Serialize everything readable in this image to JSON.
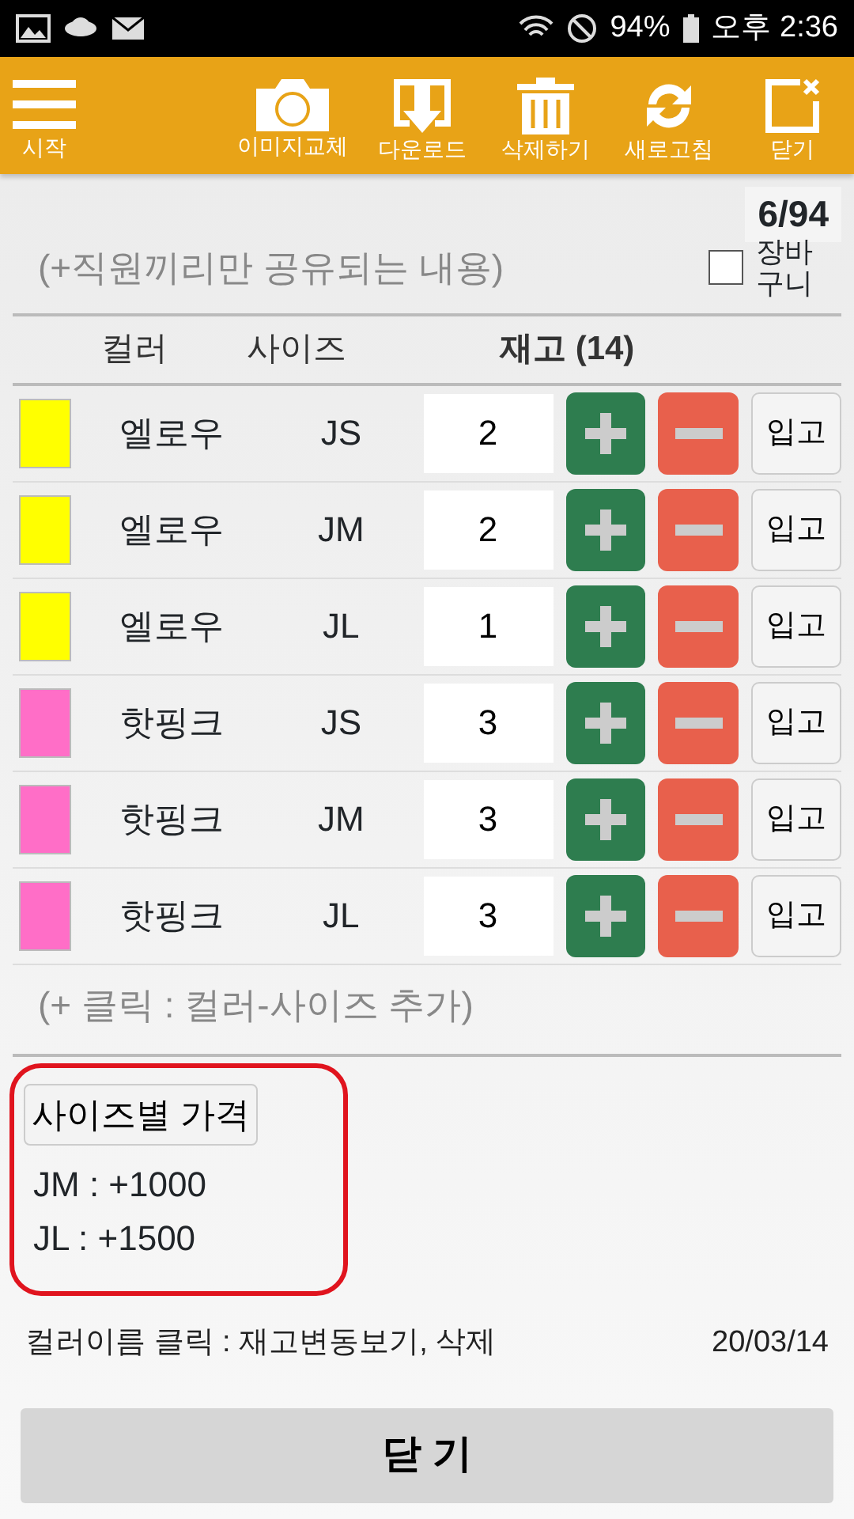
{
  "status_bar": {
    "battery": "94%",
    "time": "오후 2:36"
  },
  "toolbar": {
    "menu_label": "시작",
    "actions": [
      {
        "kind": "camera",
        "label": "이미지교체"
      },
      {
        "kind": "download",
        "label": "다운로드"
      },
      {
        "kind": "trash",
        "label": "삭제하기"
      },
      {
        "kind": "refresh",
        "label": "새로고침"
      },
      {
        "kind": "close",
        "label": "닫기"
      }
    ]
  },
  "counter": "6/94",
  "note": "(+직원끼리만 공유되는 내용)",
  "cart": {
    "label": "장바구니",
    "checked": false
  },
  "table": {
    "columns": [
      "컬러",
      "사이즈",
      "재고 (14)"
    ],
    "rows": [
      {
        "color": "#ffff00",
        "name": "엘로우",
        "size": "JS",
        "qty": "2",
        "button": "입고"
      },
      {
        "color": "#ffff00",
        "name": "엘로우",
        "size": "JM",
        "qty": "2",
        "button": "입고"
      },
      {
        "color": "#ffff00",
        "name": "엘로우",
        "size": "JL",
        "qty": "1",
        "button": "입고"
      },
      {
        "color": "#ff6ec7",
        "name": "핫핑크",
        "size": "JS",
        "qty": "3",
        "button": "입고"
      },
      {
        "color": "#ff6ec7",
        "name": "핫핑크",
        "size": "JM",
        "qty": "3",
        "button": "입고"
      },
      {
        "color": "#ff6ec7",
        "name": "핫핑크",
        "size": "JL",
        "qty": "3",
        "button": "입고"
      }
    ]
  },
  "add_note": "(+ 클릭 : 컬러-사이즈 추가)",
  "price_button": "사이즈별 가격",
  "prices": [
    "JM : +1000",
    "JL : +1500"
  ],
  "footer_hint": "컬러이름 클릭 : 재고변동보기, 삭제",
  "date": "20/03/14",
  "close_button": "닫 기"
}
